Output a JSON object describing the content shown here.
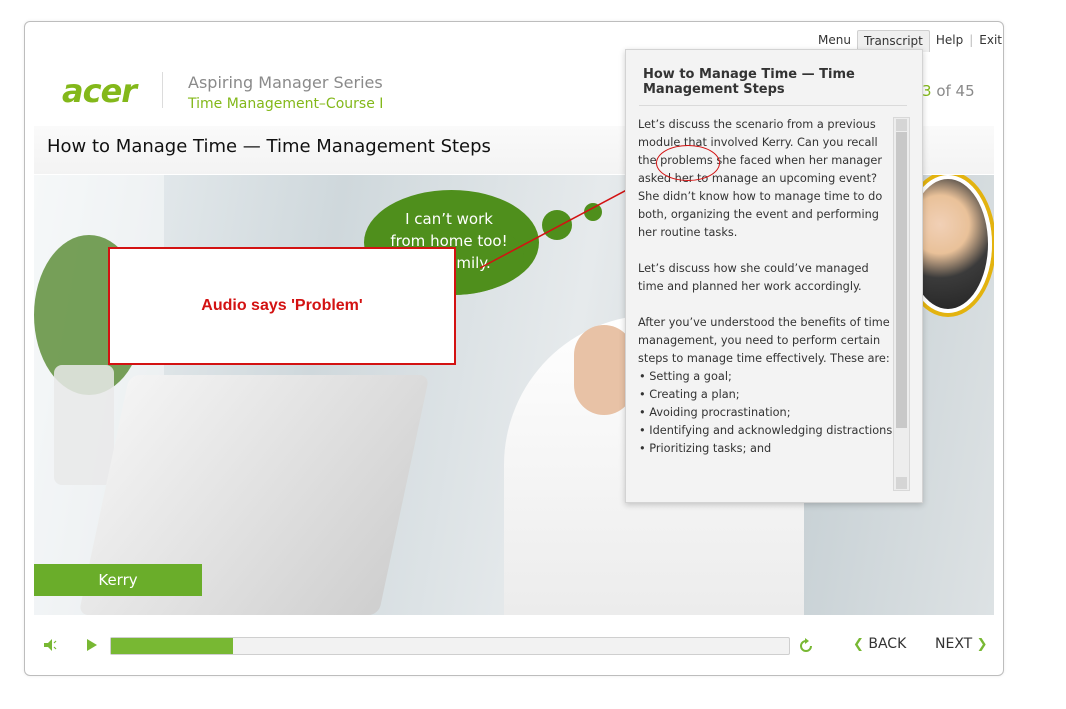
{
  "nav": {
    "menu": "Menu",
    "transcript": "Transcript",
    "help": "Help",
    "exit": "Exit",
    "sep": "|"
  },
  "brand": {
    "logo": "acer",
    "series": "Aspiring Manager Series",
    "course": "Time Management–Course I"
  },
  "page": {
    "current": "3",
    "of_text": "of 45"
  },
  "slide": {
    "title": "How to Manage Time — Time Management Steps",
    "thought": "I can’t work from home too! … family.",
    "thought_line1": "I can’t work",
    "thought_line2": "from home too!",
    "thought_line3": "amily.",
    "character_name": "Kerry"
  },
  "annotation": {
    "text": "Audio says 'Problem'"
  },
  "transcript": {
    "title": "How to Manage Time — Time Management Steps",
    "paragraphs": [
      "Let’s discuss the scenario from a previous module that involved Kerry. Can you recall the problems she faced when her manager asked her to manage an upcoming event? She didn’t know how to manage time to do both, organizing the event and performing her routine tasks.",
      "Let’s discuss how she could’ve managed time and planned her work accordingly.",
      "After you’ve understood the benefits of time management, you need to perform certain steps to manage time effectively. These are:"
    ],
    "bullets": [
      "• Setting a goal;",
      "• Creating a plan;",
      "• Avoiding procrastination;",
      "• Identifying and acknowledging distractions;",
      "• Prioritizing tasks; and"
    ]
  },
  "controls": {
    "back": "BACK",
    "next": "NEXT",
    "progress": 0.18
  },
  "icons": {
    "mute": "speaker-icon",
    "play": "play-icon",
    "replay": "replay-icon"
  },
  "colors": {
    "accent": "#78b833",
    "annotation": "#d31212",
    "bubble": "#4f8f1c"
  }
}
